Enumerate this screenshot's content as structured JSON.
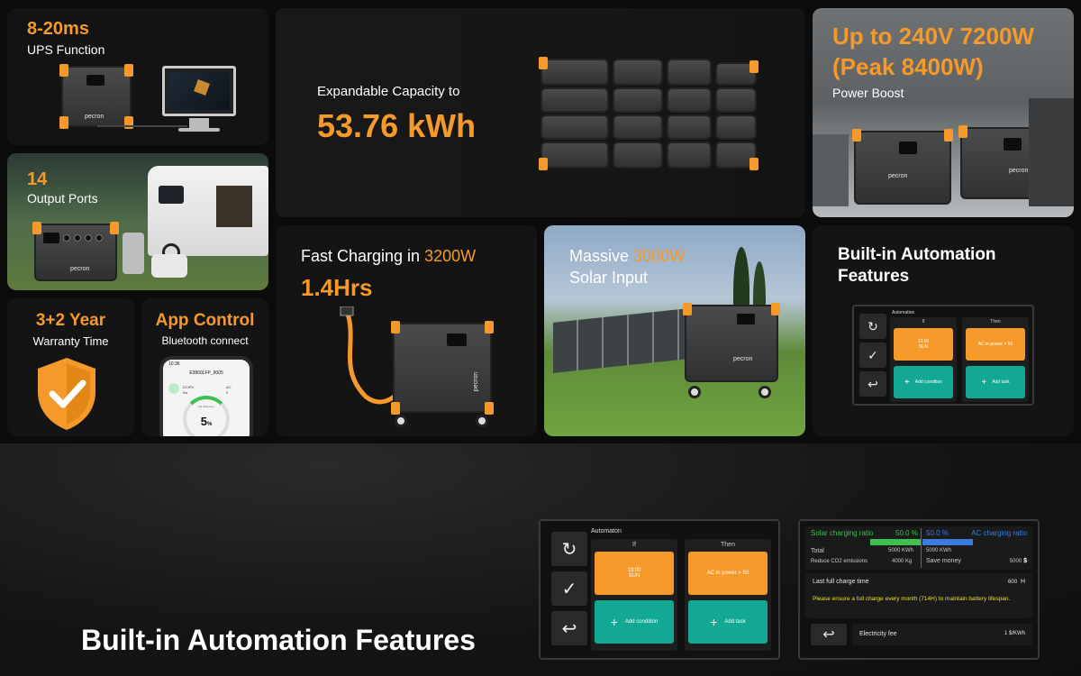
{
  "tiles": {
    "ups": {
      "title": "8-20ms",
      "subtitle": "UPS Function"
    },
    "capacity": {
      "title": "Expandable Capacity to",
      "value": "53.76 kWh"
    },
    "boost": {
      "title_line1": "Up to 240V 7200W",
      "title_line2": "(Peak 8400W)",
      "subtitle": "Power Boost"
    },
    "ports": {
      "title": "14",
      "subtitle": "Output Ports"
    },
    "charging": {
      "title_prefix": "Fast Charging in ",
      "title_highlight": "3200W",
      "value": "1.4Hrs"
    },
    "solar": {
      "title_prefix": "Massive ",
      "title_highlight": "3000W",
      "subtitle": "Solar Input"
    },
    "automation": {
      "title_line1": "Built-in Automation",
      "title_line2": "Features"
    },
    "warranty": {
      "title": "3+2 Year",
      "subtitle": "Warranty Time"
    },
    "app": {
      "title": "App Control",
      "subtitle": "Bluetooth connect"
    }
  },
  "brand": "pecron",
  "phone": {
    "time": "10:36",
    "device_id": "E3800LFP_9005",
    "dc_label": "DC/PV",
    "ac_label": "AC",
    "dc_value": "0w",
    "ac_value": "0",
    "percent": "5",
    "percent_unit": "%",
    "mode_label": "Q1 Welcome"
  },
  "automation_mini": {
    "header": "Automation",
    "if_label": "If",
    "then_label": "Then",
    "if_card": "13:00\nSUN",
    "then_card": "AC in power > 50",
    "add_condition": "Add condition",
    "add_task": "Add task"
  },
  "banner": {
    "heading": "Built-in Automation Features"
  },
  "automation_large": {
    "header": "Automaton",
    "if_label": "If",
    "then_label": "Then",
    "if_card_time": "13:00",
    "if_card_day": "SUN",
    "then_card": "AC in power > 50",
    "add_condition": "Add condition",
    "add_task": "Add task"
  },
  "stats": {
    "solar_label": "Solar charging ratio",
    "solar_value": "50.0 %",
    "ac_value": "50.0 %",
    "ac_label": "AC charging ratio",
    "total_label": "Total",
    "total_left": "5000 KWh",
    "total_right": "5000 KWh",
    "co2_label": "Reduce CO2 emissions",
    "co2_value": "4000 Kg",
    "save_label": "Save money",
    "save_value": "5000",
    "save_unit": "$",
    "last_label": "Last full charge time",
    "last_value": "600",
    "last_unit": "H",
    "notice": "Please ensure a full charge every month (714H) to maintain battery lifespan.",
    "fee_label": "Electricity fee",
    "fee_value": "1 $/KWh"
  },
  "colors": {
    "accent": "#f59a2a",
    "teal": "#12a894",
    "blue": "#3a7be0",
    "green": "#3fbf4f"
  }
}
